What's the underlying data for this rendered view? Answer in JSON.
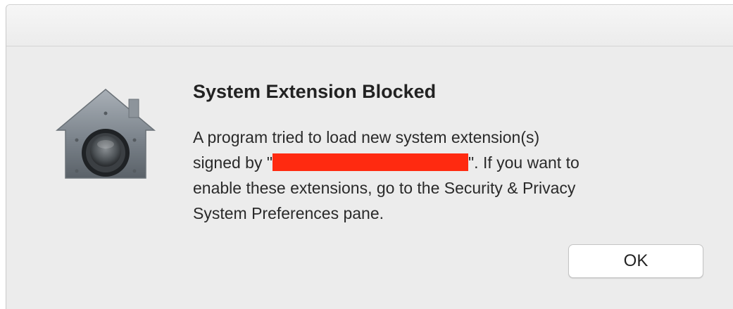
{
  "dialog": {
    "title": "System Extension Blocked",
    "message": {
      "line1": "A program tried to load new system extension(s)",
      "line2_before": "signed by \"",
      "line2_after": "\".  If you want to",
      "line3": "enable these extensions, go to the Security & Privacy",
      "line4": "System Preferences pane."
    },
    "redaction_color": "#ff2a10",
    "icon": "gatekeeper-lock-icon",
    "ok_label": "OK"
  }
}
